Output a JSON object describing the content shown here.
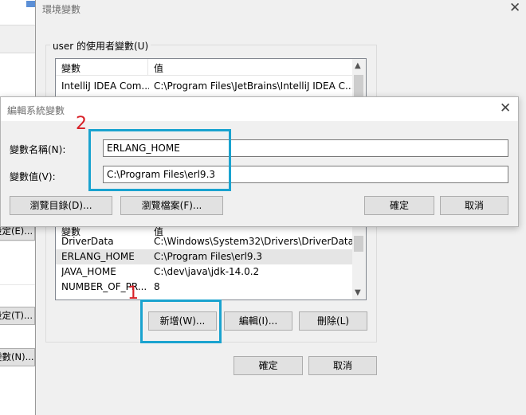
{
  "background_window": {
    "buttons": [
      "設定(E)...",
      "設定(T)...",
      "變數(N)..."
    ]
  },
  "env_window": {
    "title": "環境變數",
    "close_icon": "close-icon",
    "user_group_label": "user 的使用者變數(U)",
    "user_list": {
      "headers": [
        "變數",
        "值"
      ],
      "rows": [
        {
          "name": "IntelliJ IDEA Com...",
          "value": "C:\\Program Files\\JetBrains\\IntelliJ IDEA C..."
        }
      ]
    },
    "system_list": {
      "header_partial": [
        "變數",
        "值"
      ],
      "rows": [
        {
          "name": "DriverData",
          "value": "C:\\Windows\\System32\\Drivers\\DriverData"
        },
        {
          "name": "ERLANG_HOME",
          "value": "C:\\Program Files\\erl9.3",
          "selected": true
        },
        {
          "name": "JAVA_HOME",
          "value": "C:\\dev\\java\\jdk-14.0.2"
        },
        {
          "name": "NUMBER_OF_PR...",
          "value": "8"
        }
      ]
    },
    "system_buttons": {
      "new": "新增(W)...",
      "edit": "編輯(I)...",
      "delete": "刪除(L)"
    },
    "footer_buttons": {
      "ok": "確定",
      "cancel": "取消"
    }
  },
  "edit_dialog": {
    "title": "編輯系統變數",
    "name_label": "變數名稱(N):",
    "name_value": "ERLANG_HOME",
    "value_label": "變數值(V):",
    "value_value": "C:\\Program Files\\erl9.3",
    "browse_dir": "瀏覽目錄(D)...",
    "browse_file": "瀏覽檔案(F)...",
    "ok": "確定",
    "cancel": "取消"
  },
  "annotations": {
    "step1": "1",
    "step2": "2",
    "highlight_color": "#1aa3cf",
    "number_color": "#d81f26"
  }
}
